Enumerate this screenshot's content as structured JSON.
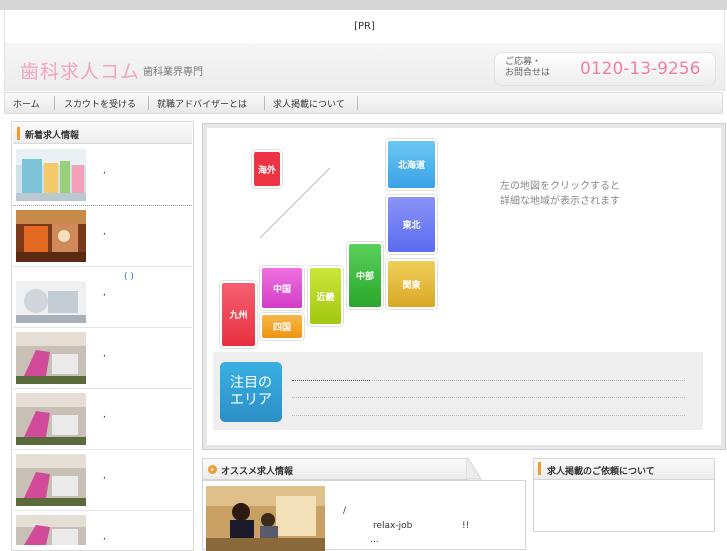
{
  "pr_label": "[PR]",
  "header": {
    "logo": "歯科求人コム",
    "tagline": "歯科業界専門",
    "contact_label_1": "ご応募・",
    "contact_label_2": "お問合せは",
    "phone": "0120-13-9256",
    "accent_color": "#ef7fa8"
  },
  "nav": [
    {
      "label": "ホーム"
    },
    {
      "label": "スカウトを受ける"
    },
    {
      "label": "就職アドバイザーとは"
    },
    {
      "label": "求人掲載について"
    }
  ],
  "sidebar": {
    "title": "新着求人情報",
    "items": [
      {
        "text": ","
      },
      {
        "text": ","
      },
      {
        "text": "( )",
        "text2": ","
      },
      {
        "text": ","
      },
      {
        "text": ","
      },
      {
        "text": ","
      },
      {
        "text": ","
      }
    ]
  },
  "map": {
    "regions": [
      {
        "name": "海外",
        "color": "#ee3344"
      },
      {
        "name": "北海道",
        "color": "#4ab3ee"
      },
      {
        "name": "東北",
        "color": "#6a7cf2"
      },
      {
        "name": "中部",
        "color": "#38b838"
      },
      {
        "name": "関東",
        "color": "#e2b32e"
      },
      {
        "name": "近畿",
        "color": "#b5d612"
      },
      {
        "name": "中国",
        "color": "#e84bd8"
      },
      {
        "name": "四国",
        "color": "#f2a21e"
      },
      {
        "name": "九州",
        "color": "#f04050"
      }
    ],
    "hint_1": "左の地図をクリックすると",
    "hint_2": "詳細な地域が表示されます"
  },
  "featured": {
    "badge_1": "注目の",
    "badge_2": "エリア"
  },
  "recommended": {
    "title": "オススメ求人情報",
    "line1": "/",
    "line2a": "relax-job",
    "line2b": "!!",
    "line3": "..."
  },
  "request": {
    "title": "求人掲載のご依頼について"
  }
}
